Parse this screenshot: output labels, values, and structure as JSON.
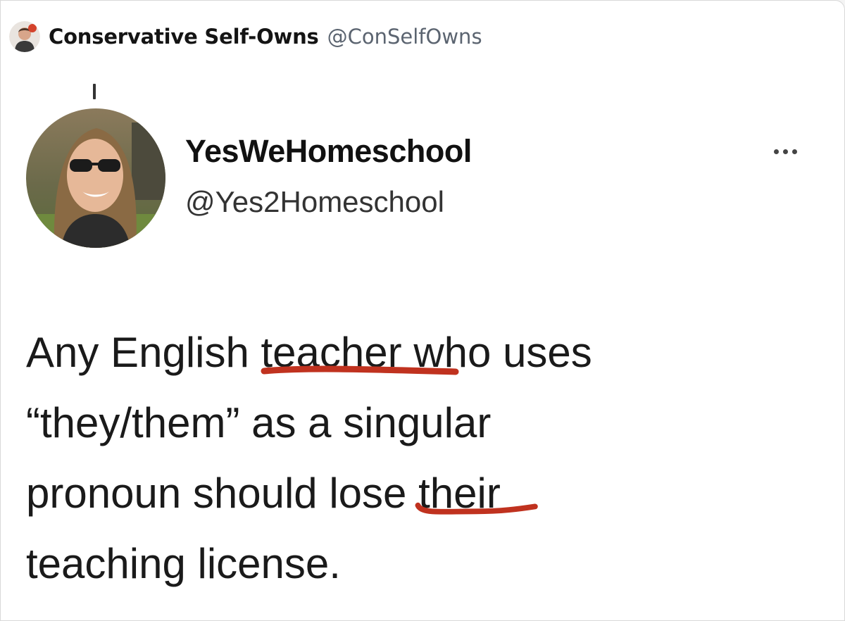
{
  "retweeter": {
    "name": "Conservative Self-Owns",
    "handle": "@ConSelfOwns"
  },
  "tweet": {
    "author_name": "YesWeHomeschool",
    "author_handle": "@Yes2Homeschool",
    "more_icon": "more-horizontal-icon",
    "lines": [
      {
        "before": "Any English ",
        "marked": "teacher",
        "after": " who uses"
      },
      {
        "before": "“they/them” as a singular",
        "marked": "",
        "after": ""
      },
      {
        "before": "pronoun should lose ",
        "marked": "their",
        "after": ""
      },
      {
        "before": "teaching license.",
        "marked": "",
        "after": ""
      }
    ]
  },
  "colors": {
    "underline": "#c0321f",
    "handle_gray": "#5b6470"
  }
}
